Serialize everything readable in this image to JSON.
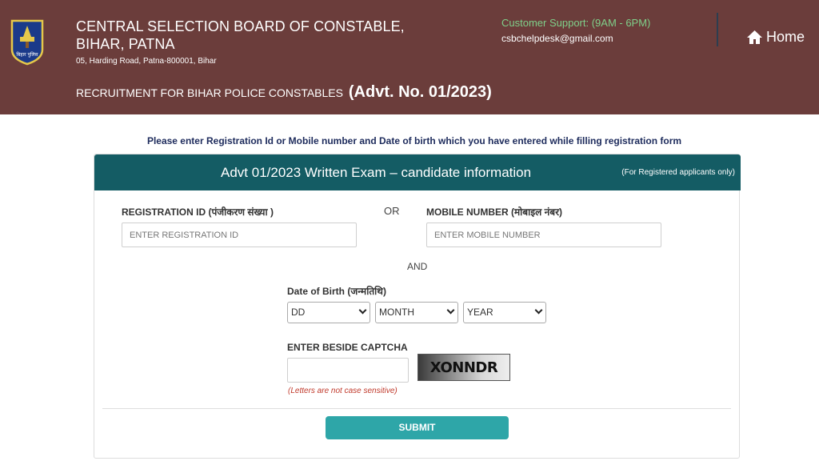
{
  "header": {
    "title": "CENTRAL SELECTION BOARD OF CONSTABLE, BIHAR, PATNA",
    "address": "05, Harding Road, Patna-800001, Bihar",
    "recruitment_text": "RECRUITMENT FOR BIHAR POLICE CONSTABLES",
    "advt_no": "(Advt. No. 01/2023)",
    "support_title": "Customer Support: (9AM - 6PM)",
    "support_email": "csbchelpdesk@gmail.com",
    "home_label": "Home",
    "logo_text": "बिहार पुलिस",
    "logo_icon": "bihar-police-emblem",
    "home_icon": "house-icon",
    "bg_color": "#6b3d3b"
  },
  "instruction": "Please enter Registration Id or Mobile number and Date of birth which you have entered while filling registration form",
  "card": {
    "title": "Advt 01/2023 Written Exam – candidate information",
    "note": "(For Registered applicants only)",
    "header_color": "#145c64"
  },
  "form": {
    "registration_label": "REGISTRATION ID (पंजीकरण संख्या )",
    "registration_placeholder": "ENTER REGISTRATION ID",
    "or_text": "OR",
    "mobile_label": "MOBILE NUMBER (मोबाइल नंबर)",
    "mobile_placeholder": "ENTER MOBILE NUMBER",
    "and_text": "AND",
    "dob_label": "Date of Birth (जन्मतिथि)",
    "dob_day": "DD",
    "dob_month": "MONTH",
    "dob_year": "YEAR",
    "captcha_label": "ENTER BESIDE CAPTCHA",
    "captcha_value": "",
    "captcha_text": "XONNDR",
    "captcha_hint": "(Letters are not case sensitive)",
    "submit_label": "SUBMIT",
    "submit_color": "#2ea6a8"
  }
}
